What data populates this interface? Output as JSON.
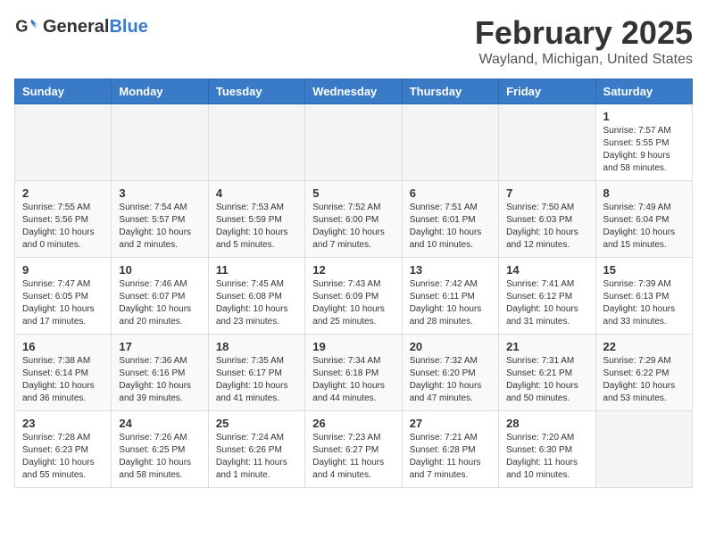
{
  "header": {
    "logo_general": "General",
    "logo_blue": "Blue",
    "title": "February 2025",
    "subtitle": "Wayland, Michigan, United States"
  },
  "weekdays": [
    "Sunday",
    "Monday",
    "Tuesday",
    "Wednesday",
    "Thursday",
    "Friday",
    "Saturday"
  ],
  "weeks": [
    [
      {
        "day": "",
        "info": ""
      },
      {
        "day": "",
        "info": ""
      },
      {
        "day": "",
        "info": ""
      },
      {
        "day": "",
        "info": ""
      },
      {
        "day": "",
        "info": ""
      },
      {
        "day": "",
        "info": ""
      },
      {
        "day": "1",
        "info": "Sunrise: 7:57 AM\nSunset: 5:55 PM\nDaylight: 9 hours\nand 58 minutes."
      }
    ],
    [
      {
        "day": "2",
        "info": "Sunrise: 7:55 AM\nSunset: 5:56 PM\nDaylight: 10 hours\nand 0 minutes."
      },
      {
        "day": "3",
        "info": "Sunrise: 7:54 AM\nSunset: 5:57 PM\nDaylight: 10 hours\nand 2 minutes."
      },
      {
        "day": "4",
        "info": "Sunrise: 7:53 AM\nSunset: 5:59 PM\nDaylight: 10 hours\nand 5 minutes."
      },
      {
        "day": "5",
        "info": "Sunrise: 7:52 AM\nSunset: 6:00 PM\nDaylight: 10 hours\nand 7 minutes."
      },
      {
        "day": "6",
        "info": "Sunrise: 7:51 AM\nSunset: 6:01 PM\nDaylight: 10 hours\nand 10 minutes."
      },
      {
        "day": "7",
        "info": "Sunrise: 7:50 AM\nSunset: 6:03 PM\nDaylight: 10 hours\nand 12 minutes."
      },
      {
        "day": "8",
        "info": "Sunrise: 7:49 AM\nSunset: 6:04 PM\nDaylight: 10 hours\nand 15 minutes."
      }
    ],
    [
      {
        "day": "9",
        "info": "Sunrise: 7:47 AM\nSunset: 6:05 PM\nDaylight: 10 hours\nand 17 minutes."
      },
      {
        "day": "10",
        "info": "Sunrise: 7:46 AM\nSunset: 6:07 PM\nDaylight: 10 hours\nand 20 minutes."
      },
      {
        "day": "11",
        "info": "Sunrise: 7:45 AM\nSunset: 6:08 PM\nDaylight: 10 hours\nand 23 minutes."
      },
      {
        "day": "12",
        "info": "Sunrise: 7:43 AM\nSunset: 6:09 PM\nDaylight: 10 hours\nand 25 minutes."
      },
      {
        "day": "13",
        "info": "Sunrise: 7:42 AM\nSunset: 6:11 PM\nDaylight: 10 hours\nand 28 minutes."
      },
      {
        "day": "14",
        "info": "Sunrise: 7:41 AM\nSunset: 6:12 PM\nDaylight: 10 hours\nand 31 minutes."
      },
      {
        "day": "15",
        "info": "Sunrise: 7:39 AM\nSunset: 6:13 PM\nDaylight: 10 hours\nand 33 minutes."
      }
    ],
    [
      {
        "day": "16",
        "info": "Sunrise: 7:38 AM\nSunset: 6:14 PM\nDaylight: 10 hours\nand 36 minutes."
      },
      {
        "day": "17",
        "info": "Sunrise: 7:36 AM\nSunset: 6:16 PM\nDaylight: 10 hours\nand 39 minutes."
      },
      {
        "day": "18",
        "info": "Sunrise: 7:35 AM\nSunset: 6:17 PM\nDaylight: 10 hours\nand 41 minutes."
      },
      {
        "day": "19",
        "info": "Sunrise: 7:34 AM\nSunset: 6:18 PM\nDaylight: 10 hours\nand 44 minutes."
      },
      {
        "day": "20",
        "info": "Sunrise: 7:32 AM\nSunset: 6:20 PM\nDaylight: 10 hours\nand 47 minutes."
      },
      {
        "day": "21",
        "info": "Sunrise: 7:31 AM\nSunset: 6:21 PM\nDaylight: 10 hours\nand 50 minutes."
      },
      {
        "day": "22",
        "info": "Sunrise: 7:29 AM\nSunset: 6:22 PM\nDaylight: 10 hours\nand 53 minutes."
      }
    ],
    [
      {
        "day": "23",
        "info": "Sunrise: 7:28 AM\nSunset: 6:23 PM\nDaylight: 10 hours\nand 55 minutes."
      },
      {
        "day": "24",
        "info": "Sunrise: 7:26 AM\nSunset: 6:25 PM\nDaylight: 10 hours\nand 58 minutes."
      },
      {
        "day": "25",
        "info": "Sunrise: 7:24 AM\nSunset: 6:26 PM\nDaylight: 11 hours\nand 1 minute."
      },
      {
        "day": "26",
        "info": "Sunrise: 7:23 AM\nSunset: 6:27 PM\nDaylight: 11 hours\nand 4 minutes."
      },
      {
        "day": "27",
        "info": "Sunrise: 7:21 AM\nSunset: 6:28 PM\nDaylight: 11 hours\nand 7 minutes."
      },
      {
        "day": "28",
        "info": "Sunrise: 7:20 AM\nSunset: 6:30 PM\nDaylight: 11 hours\nand 10 minutes."
      },
      {
        "day": "",
        "info": ""
      }
    ]
  ]
}
